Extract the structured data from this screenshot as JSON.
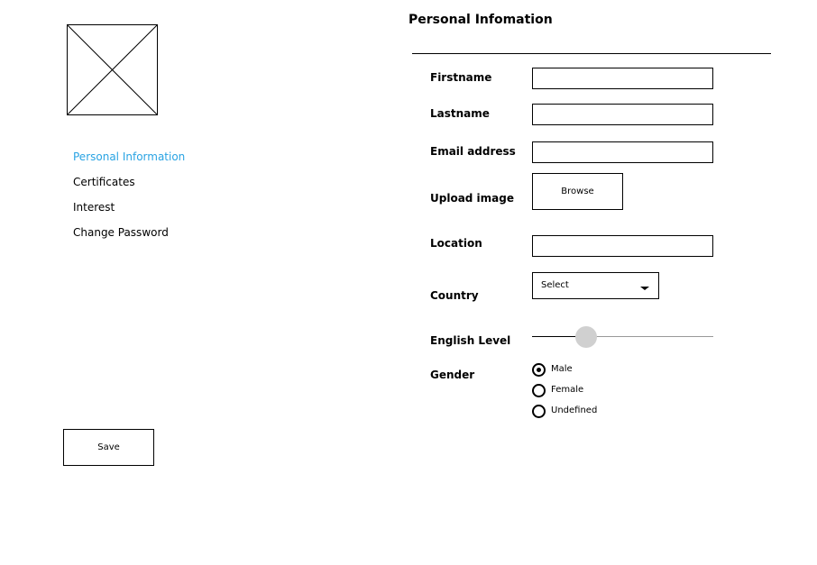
{
  "sidebar": {
    "items": [
      {
        "label": "Personal Information",
        "active": true
      },
      {
        "label": "Certificates",
        "active": false
      },
      {
        "label": "Interest",
        "active": false
      },
      {
        "label": "Change Password",
        "active": false
      }
    ],
    "save_label": "Save"
  },
  "main": {
    "title": "Personal Infomation",
    "labels": {
      "firstname": "Firstname",
      "lastname": "Lastname",
      "email": "Email address",
      "upload": "Upload image",
      "location": "Location",
      "country": "Country",
      "english_level": "English Level",
      "gender": "Gender"
    },
    "fields": {
      "firstname": "",
      "lastname": "",
      "email": "",
      "location": ""
    },
    "browse_label": "Browse",
    "country_select": {
      "value": "Select"
    },
    "english_level": {
      "value": 0.3
    },
    "gender": {
      "options": [
        "Male",
        "Female",
        "Undefined"
      ],
      "selected": "Male"
    }
  },
  "colors": {
    "active_nav": "#29a3e3",
    "slider_thumb": "#d0d0d0"
  },
  "icons": [
    "image-placeholder-icon",
    "chevron-down-icon"
  ]
}
